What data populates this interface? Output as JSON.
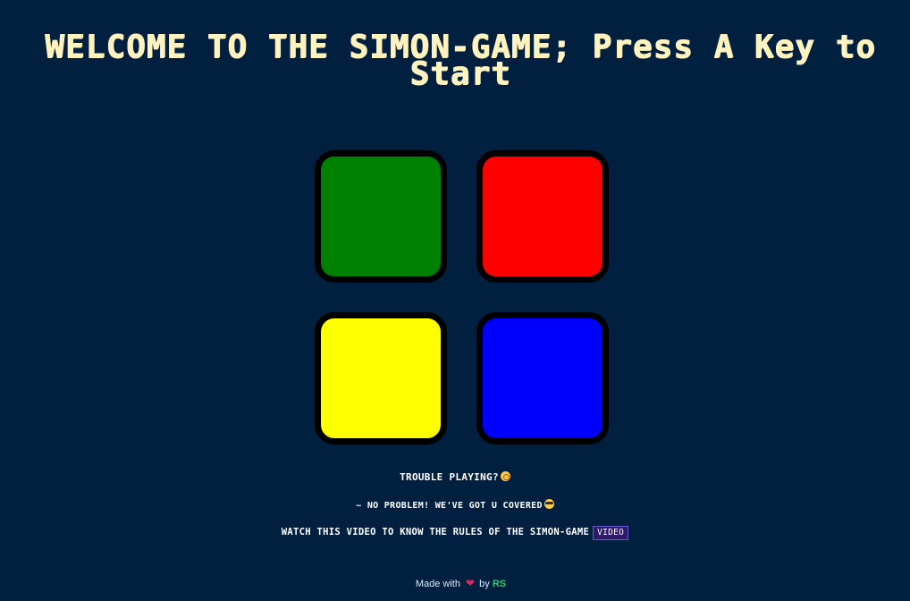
{
  "title": "WELCOME TO THE SIMON-GAME; Press A Key to Start",
  "buttons": [
    {
      "id": "green",
      "color": "#008000"
    },
    {
      "id": "red",
      "color": "#ff0000"
    },
    {
      "id": "yellow",
      "color": "#ffff00"
    },
    {
      "id": "blue",
      "color": "#0000ff"
    }
  ],
  "info": {
    "trouble": "TROUBLE PLAYING?",
    "trouble_emoji": "flushed-face-icon",
    "covered": "~ NO PROBLEM! WE'VE GOT U COVERED",
    "covered_emoji": "sunglasses-face-icon",
    "watch": "WATCH THIS VIDEO TO KNOW THE RULES OF THE SIMON-GAME",
    "video_label": "VIDEO"
  },
  "footer": {
    "made_with": "Made with",
    "heart": "❤",
    "by": "by",
    "author": "RS"
  },
  "colors": {
    "background": "#011f3f",
    "title": "#fef2bf",
    "author": "#2ecc71"
  }
}
